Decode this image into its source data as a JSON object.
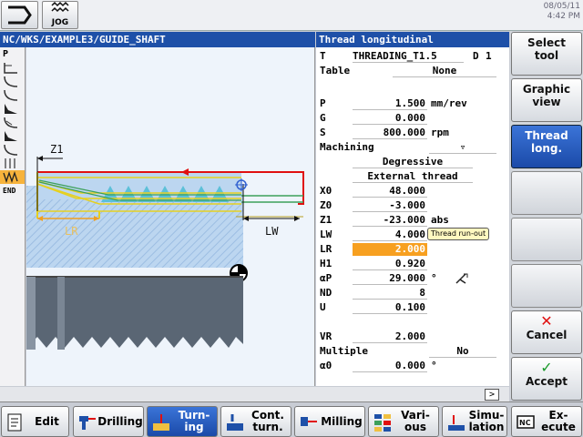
{
  "datetime": {
    "date": "08/05/11",
    "time": "4:42 PM"
  },
  "jog_label": "JOG",
  "path": "NC/WKS/EXAMPLE3/GUIDE_SHAFT",
  "form_title": "Thread longitudinal",
  "strip": {
    "top": "P",
    "bottom": "END"
  },
  "graphic_labels": {
    "z1": "Z1",
    "lr": "LR",
    "lw": "LW"
  },
  "form": {
    "t_label": "T",
    "t_value": "THREADING_T1.5",
    "d_label": "D",
    "d_value": "1",
    "table_label": "Table",
    "table_value": "None",
    "p_label": "P",
    "p_value": "1.500",
    "p_unit": "mm/rev",
    "g_label": "G",
    "g_value": "0.000",
    "s_label": "S",
    "s_value": "800.000",
    "s_unit": "rpm",
    "machining_label": "Machining",
    "machining_value": "▿",
    "degressive": "Degressive",
    "external": "External thread",
    "x0_label": "X0",
    "x0_value": "48.000",
    "z0_label": "Z0",
    "z0_value": "-3.000",
    "z1_label": "Z1",
    "z1_value": "-23.000",
    "z1_unit": "abs",
    "lw_label": "LW",
    "lw_value": "4.000",
    "lr_label": "LR",
    "lr_value": "2.000",
    "h1_label": "H1",
    "h1_value": "0.920",
    "ap_label": "αP",
    "ap_value": "29.000",
    "ap_unit": "°",
    "nd_label": "ND",
    "nd_value": "8",
    "u_label": "U",
    "u_value": "0.100",
    "vr_label": "VR",
    "vr_value": "2.000",
    "multiple_label": "Multiple",
    "multiple_value": "No",
    "a0_label": "α0",
    "a0_value": "0.000",
    "a0_unit": "°"
  },
  "tooltip": "Thread run-out",
  "vertical_softkeys": {
    "select_tool": [
      "Select",
      "tool"
    ],
    "graphic_view": [
      "Graphic",
      "view"
    ],
    "thread_long": [
      "Thread",
      "long."
    ],
    "cancel": "Cancel",
    "accept": "Accept"
  },
  "horizontal_softkeys": {
    "edit": "Edit",
    "drilling": "Drilling",
    "turning": [
      "Turn-",
      "ing"
    ],
    "contour": [
      "Cont.",
      "turn."
    ],
    "milling": "Milling",
    "various": [
      "Vari-",
      "ous"
    ],
    "simulation": [
      "Simu-",
      "lation"
    ],
    "execute": [
      "Ex-",
      "ecute"
    ]
  },
  "page_arrow": ">",
  "colors": {
    "title_blue": "#1e50a8",
    "highlight_orange": "#f7a020",
    "cancel_red": "#e01010",
    "accept_green": "#1a9a2a"
  }
}
